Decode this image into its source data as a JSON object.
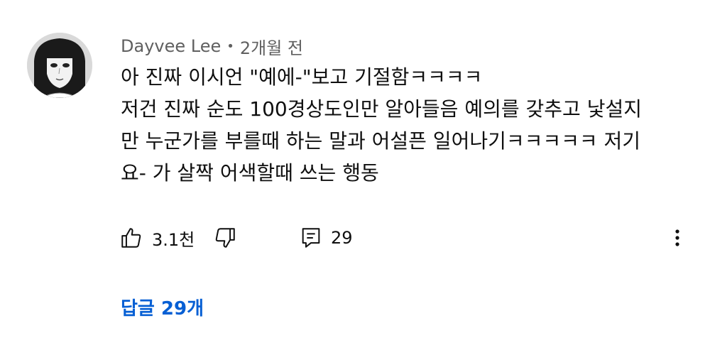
{
  "comment": {
    "author": "Dayvee Lee",
    "separator": "•",
    "time": "2개월 전",
    "lines": [
      "아 진짜 이시언 \"예에-\"보고 기절함ㅋㅋㅋㅋ",
      "저건 진짜 순도 100경상도인만 알아들음 예의를 갖추고 낯설지",
      "만 누군가를 부를때 하는 말과 어설픈 일어나기ㅋㅋㅋㅋㅋ 저기",
      "요- 가 살짝 어색할때 쓰는 행동"
    ],
    "avatar_icon": "user-avatar-illustration"
  },
  "actions": {
    "like_icon": "thumbs-up-icon",
    "like_count": "3.1천",
    "dislike_icon": "thumbs-down-icon",
    "reply_icon": "reply-comment-icon",
    "reply_count": "29",
    "more_icon": "more-vertical-icon"
  },
  "replies": {
    "toggle_label": "답글 29개",
    "color": "#065fd4"
  }
}
